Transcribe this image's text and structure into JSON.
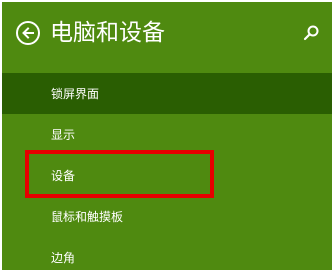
{
  "header": {
    "title": "电脑和设备",
    "back_icon": "back-arrow-icon",
    "search_icon": "search-icon"
  },
  "menu": {
    "items": [
      {
        "label": "锁屏界面",
        "selected": true
      },
      {
        "label": "显示",
        "selected": false
      },
      {
        "label": "设备",
        "selected": false
      },
      {
        "label": "鼠标和触摸板",
        "selected": false
      },
      {
        "label": "边角",
        "selected": false
      }
    ]
  },
  "colors": {
    "background": "#4f8a10",
    "selected_item": "#2a5e02",
    "highlight_box": "#e60000",
    "text": "#ffffff"
  }
}
